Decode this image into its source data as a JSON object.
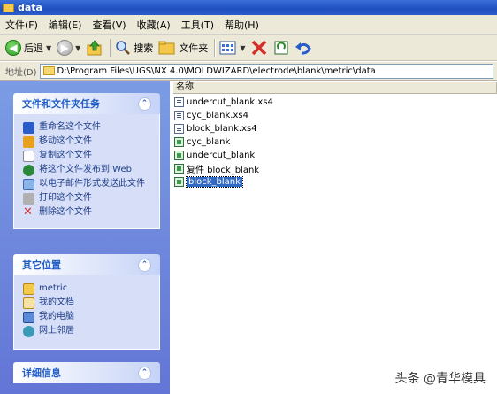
{
  "window": {
    "title": "data"
  },
  "menu": [
    "文件(F)",
    "编辑(E)",
    "查看(V)",
    "收藏(A)",
    "工具(T)",
    "帮助(H)"
  ],
  "toolbar": {
    "back": "后退",
    "search": "搜索",
    "folders": "文件夹"
  },
  "address": {
    "label": "地址(D)",
    "path": "D:\\Program Files\\UGS\\NX 4.0\\MOLDWIZARD\\electrode\\blank\\metric\\data"
  },
  "tasks": {
    "title": "文件和文件夹任务",
    "items": [
      "重命名这个文件",
      "移动这个文件",
      "复制这个文件",
      "将这个文件发布到 Web",
      "以电子邮件形式发送此文件",
      "打印这个文件",
      "删除这个文件"
    ]
  },
  "places": {
    "title": "其它位置",
    "items": [
      "metric",
      "我的文档",
      "我的电脑",
      "网上邻居"
    ]
  },
  "details": {
    "title": "详细信息"
  },
  "filelist": {
    "column": "名称",
    "files": [
      {
        "name": "undercut_blank.xs4",
        "type": "doc"
      },
      {
        "name": "cyc_blank.xs4",
        "type": "doc"
      },
      {
        "name": "block_blank.xs4",
        "type": "doc"
      },
      {
        "name": "cyc_blank",
        "type": "prt"
      },
      {
        "name": "undercut_blank",
        "type": "prt"
      },
      {
        "name": "复件 block_blank",
        "type": "prt"
      },
      {
        "name": "block_blank",
        "type": "prt",
        "selected": true
      }
    ]
  },
  "watermark": "头条 @青华模具"
}
